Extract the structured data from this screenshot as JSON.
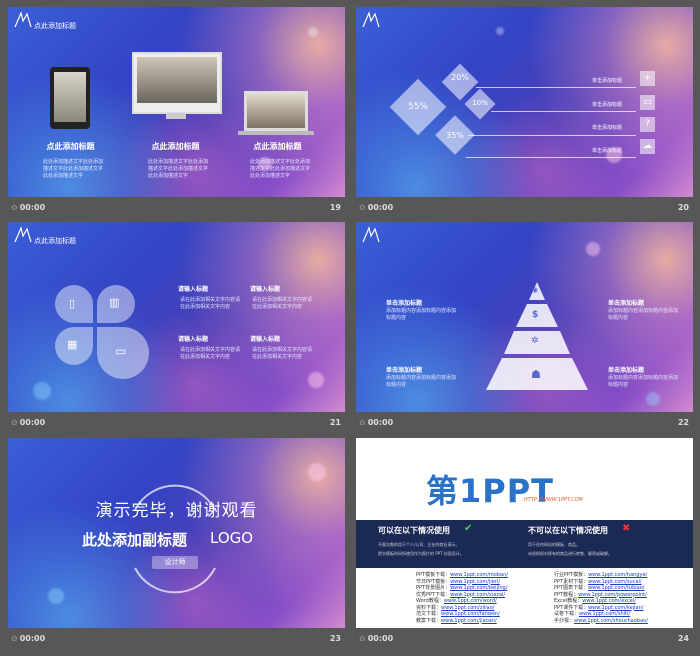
{
  "slides": [
    {
      "number": "19",
      "time": "00:00",
      "title": "点此添加标题",
      "columns": [
        {
          "heading": "点此添加标题",
          "text": "此处添加描述文字此处添加描述文字此处添加描述文字此处添加描述文字"
        },
        {
          "heading": "点此添加标题",
          "text": "此处添加描述文字此处添加描述文字此处添加描述文字此处添加描述文字"
        },
        {
          "heading": "点此添加标题",
          "text": "此处添加描述文字此处添加描述文字此处添加描述文字此处添加描述文字"
        }
      ]
    },
    {
      "number": "20",
      "time": "00:00",
      "percents": [
        "55%",
        "20%",
        "10%",
        "35%"
      ],
      "items": [
        "单击添加标题",
        "单击添加标题",
        "单击添加标题",
        "单击添加标题"
      ]
    },
    {
      "number": "21",
      "time": "00:00",
      "title": "点此添加标题",
      "blocks": [
        {
          "label": "请输入标题",
          "text": "请在此添加相关文字内容请在此添加相关文字内容"
        },
        {
          "label": "请输入标题",
          "text": "请在此添加相关文字内容请在此添加相关文字内容"
        },
        {
          "label": "请输入标题",
          "text": "请在此添加相关文字内容请在此添加相关文字内容"
        },
        {
          "label": "请输入标题",
          "text": "请在此添加相关文字内容请在此添加相关文字内容"
        }
      ]
    },
    {
      "number": "22",
      "time": "00:00",
      "labels": [
        {
          "title": "单击添加标题",
          "text": "添加标题内容添加标题内容添加标题内容"
        },
        {
          "title": "单击添加标题",
          "text": "添加标题内容添加标题内容添加标题内容"
        },
        {
          "title": "单击添加标题",
          "text": "添加标题内容添加标题内容添加标题内容"
        },
        {
          "title": "单击添加标题",
          "text": "添加标题内容添加标题内容添加标题内容"
        }
      ]
    },
    {
      "number": "23",
      "time": "00:00",
      "main": "演示完毕，谢谢观看",
      "sub": "此处添加副标题",
      "logo": "LOGO",
      "designer": "设计师"
    },
    {
      "number": "24",
      "time": "00:00",
      "brand_main": "第1PPT",
      "brand_url": "HTTP://WWW.1PPT.COM",
      "can_use": "可以在以下情况使用",
      "cannot_use": "不可以在以下情况使用",
      "can_notes": [
        "不限次数的用于个人/公司、企业的商业演示。",
        "提交模板时间所使用作为图片的 PPT 封面设计。"
      ],
      "cannot_notes": [
        "用于任何网站的模板、商品。",
        "未经授权对原有的商品进行转售、解密或破解。"
      ],
      "left_links": [
        {
          "k": "PPT模板下载：",
          "v": "www.1ppt.com/moban/"
        },
        {
          "k": "节日PPT模板：",
          "v": "www.1ppt.com/jieri/"
        },
        {
          "k": "PPT背景图片：",
          "v": "www.1ppt.com/beijing/"
        },
        {
          "k": "优秀PPT下载：",
          "v": "www.1ppt.com/xiazai/"
        },
        {
          "k": "Word教程：",
          "v": "www.1ppt.com/word/"
        },
        {
          "k": "资料下载：",
          "v": "www.1ppt.com/ziliao/"
        },
        {
          "k": "范文下载：",
          "v": "www.1ppt.com/fanwen/"
        },
        {
          "k": "教案下载：",
          "v": "www.1ppt.com/jiaoan/"
        }
      ],
      "right_links": [
        {
          "k": "行业PPT模板：",
          "v": "www.1ppt.com/hangye/"
        },
        {
          "k": "PPT素材下载：",
          "v": "www.1ppt.com/sucai/"
        },
        {
          "k": "PPT图表下载：",
          "v": "www.1ppt.com/tubiao/"
        },
        {
          "k": "PPT教程：",
          "v": "www.1ppt.com/powerpoint/"
        },
        {
          "k": "Excel教程：",
          "v": "www.1ppt.com/excel/"
        },
        {
          "k": "PPT课件下载：",
          "v": "www.1ppt.com/kejian/"
        },
        {
          "k": "试卷下载：",
          "v": "www.1ppt.com/shiti/"
        },
        {
          "k": "手抄报：",
          "v": "www.1ppt.com/shouchaobao/"
        }
      ]
    }
  ]
}
